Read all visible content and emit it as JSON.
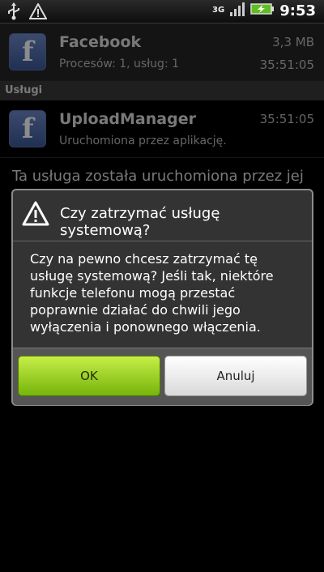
{
  "status_bar": {
    "network": "3G",
    "time": "9:53",
    "icons": [
      "usb-icon",
      "warning-icon",
      "signal-icon",
      "battery-charging-icon"
    ]
  },
  "background": {
    "app1": {
      "name": "Facebook",
      "size": "3,3 MB",
      "processes": "Procesów: 1, usług: 1",
      "time": "35:51:05"
    },
    "section_label": "Usługi",
    "app2": {
      "name": "UploadManager",
      "started_by": "Uruchomiona przez aplikację.",
      "time": "35:51:05"
    },
    "description": "Ta usługa została uruchomiona przez jej"
  },
  "dialog": {
    "title": "Czy zatrzymać usługę systemową?",
    "message": "Czy na pewno chcesz zatrzymać tę usługę systemową? Jeśli tak, niektóre funkcje telefonu mogą przestać poprawnie działać do chwili jego wyłączenia i ponownego włączenia.",
    "ok_label": "OK",
    "cancel_label": "Anuluj"
  },
  "colors": {
    "ok_button": "#8cc418",
    "dialog_bg": "#333333",
    "accent": "#3b5998"
  }
}
